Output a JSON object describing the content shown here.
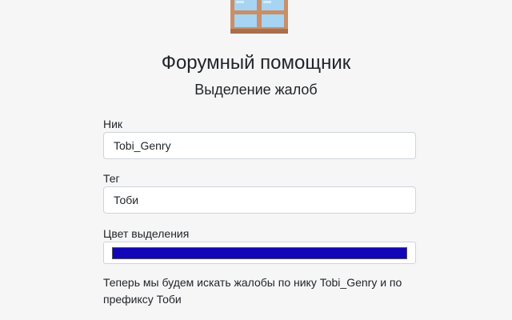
{
  "header": {
    "title": "Форумный помощник",
    "subtitle": "Выделение жалоб",
    "logo_icon": "window-icon"
  },
  "form": {
    "nick": {
      "label": "Ник",
      "value": "Tobi_Genry"
    },
    "tag": {
      "label": "Тег",
      "value": "Тоби"
    },
    "highlight_color": {
      "label": "Цвет выделения",
      "value": "#1306b8"
    }
  },
  "info": {
    "message": "Теперь мы будем искать жалобы по нику Tobi_Genry и по префиксу Тоби"
  },
  "colors": {
    "background": "#f6f6f7",
    "frame": "#c98f68",
    "glass": "#a6d4f2"
  }
}
